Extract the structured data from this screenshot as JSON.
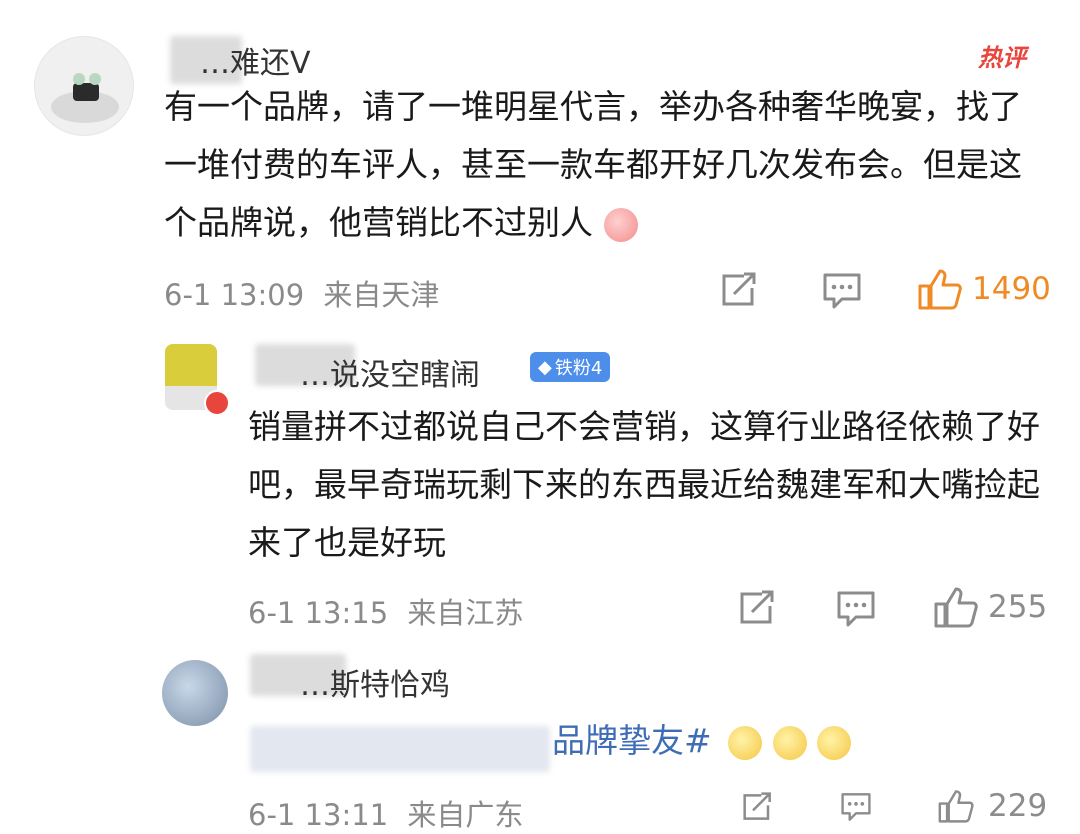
{
  "comment1": {
    "username": "…难还V",
    "hot_label": "热评",
    "text": "有一个品牌，请了一堆明星代言，举办各种奢华晚宴，找了一堆付费的车评人，甚至一款车都开好几次发布会。但是这个品牌说，他营销比不过别人",
    "time": "6-1 13:09",
    "location": "来自天津",
    "likes": "1490",
    "liked": true
  },
  "reply1": {
    "username": "…说没空瞎闹",
    "badge": "铁粉4",
    "text": "销量拼不过都说自己不会营销，这算行业路径依赖了好吧，最早奇瑞玩剩下来的东西最近给魏建军和大嘴捡起来了也是好玩",
    "time": "6-1 13:15",
    "location": "来自江苏",
    "likes": "255"
  },
  "reply2": {
    "username": "…斯特恰鸡",
    "text": "品牌挚友#",
    "time": "6-1 13:11",
    "location": "来自广东",
    "likes": "229"
  },
  "colors": {
    "accent_orange": "#f08a24",
    "hot_red": "#e8463c",
    "badge_blue": "#4d8eea"
  }
}
